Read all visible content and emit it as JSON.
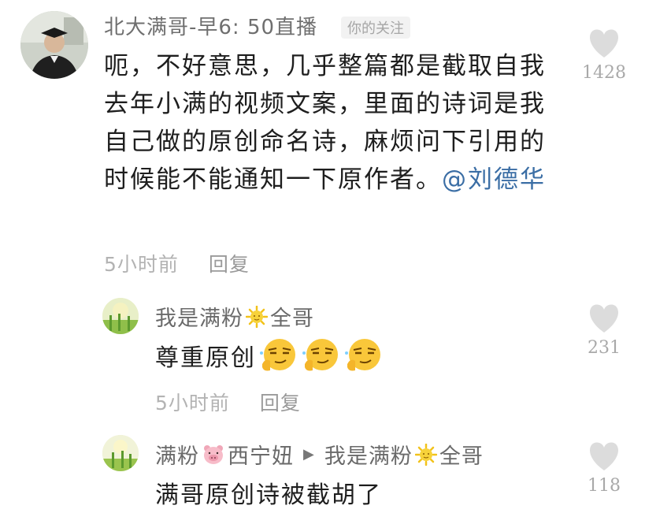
{
  "comment": {
    "username": "北大满哥-早6: 50直播",
    "tag": "你的关注",
    "text": "呃，不好意思，几乎整篇都是截取自我去年小满的视频文案，里面的诗词是我自己做的原创命名诗，麻烦问下引用的时候能不能通知一下原作者。",
    "mention": "@刘德华",
    "time": "5小时前",
    "reply_label": "回复",
    "likes": "1428"
  },
  "replies": [
    {
      "name_a": "我是满粉",
      "name_b": "全哥",
      "text": "尊重原创",
      "emoji": "smirk-emoji",
      "time": "5小时前",
      "reply_label": "回复",
      "likes": "231"
    },
    {
      "from_a": "满粉",
      "from_b": "西宁妞",
      "to_a": "我是满粉",
      "to_b": "全哥",
      "text": "满哥原创诗被截胡了",
      "likes": "118"
    }
  ],
  "colors": {
    "like_heart": "#dcdcdc",
    "mention": "#3b6ea5",
    "meta_text": "#b3b3b3"
  }
}
